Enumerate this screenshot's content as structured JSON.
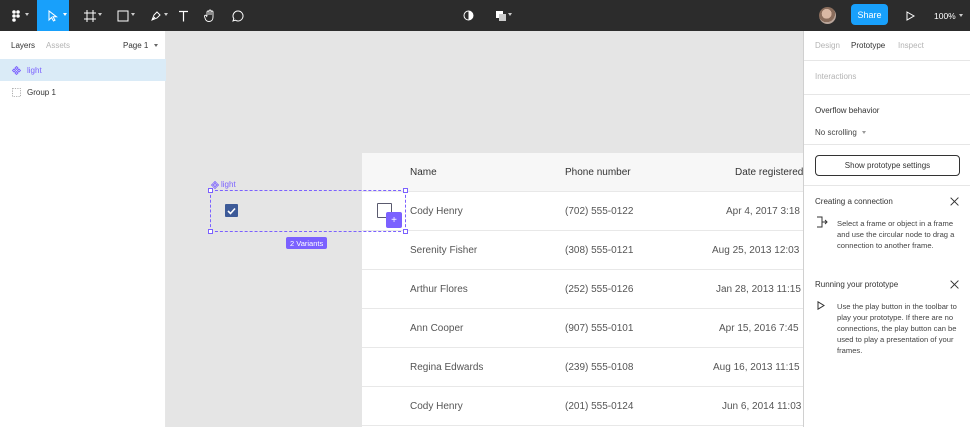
{
  "toolbar": {
    "share_label": "Share",
    "zoom": "100%",
    "brand_color": "#18a0fb"
  },
  "left_panel": {
    "tabs": [
      "Layers",
      "Assets"
    ],
    "page_selector": "Page 1",
    "layers": [
      {
        "label": "light",
        "selected": true
      },
      {
        "label": "Group 1",
        "selected": false
      }
    ]
  },
  "canvas": {
    "component_label": "light",
    "variants_badge": "2 Variants",
    "table": {
      "headers": [
        "Name",
        "Phone number",
        "Date registered"
      ],
      "rows": [
        [
          "Cody Henry",
          "(702) 555-0122",
          "Apr 4, 2017 3:18"
        ],
        [
          "Serenity Fisher",
          "(308) 555-0121",
          "Aug 25, 2013 12:03"
        ],
        [
          "Arthur Flores",
          "(252) 555-0126",
          "Jan 28, 2013 11:15"
        ],
        [
          "Ann Cooper",
          "(907) 555-0101",
          "Apr 15, 2016 7:45"
        ],
        [
          "Regina Edwards",
          "(239) 555-0108",
          "Aug 16, 2013 11:15"
        ],
        [
          "Cody Henry",
          "(201) 555-0124",
          "Jun 6, 2014 11:03"
        ]
      ]
    }
  },
  "right_panel": {
    "tabs": [
      "Design",
      "Prototype",
      "Inspect"
    ],
    "interactions_label": "Interactions",
    "overflow_title": "Overflow behavior",
    "overflow_value": "No scrolling",
    "show_settings_button": "Show prototype settings",
    "creating_title": "Creating a connection",
    "creating_text": "Select a frame or object in a frame and use the circular node to drag a connection to another frame.",
    "running_title": "Running your prototype",
    "running_text": "Use the play button in the toolbar to play your prototype. If there are no connections, the play button can be used to play a presentation of your frames."
  }
}
